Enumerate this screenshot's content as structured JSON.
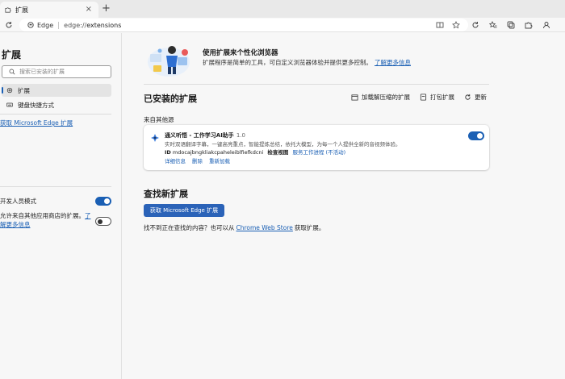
{
  "tab": {
    "title": "扩展",
    "close": "×",
    "new_tab": "+"
  },
  "address": {
    "site": "Edge",
    "url_prefix": "edge://",
    "url_path": "extensions"
  },
  "sidebar": {
    "title": "扩展",
    "search_placeholder": "搜索已安装的扩展",
    "items": [
      {
        "label": "扩展",
        "icon": "gear-icon",
        "active": true
      },
      {
        "label": "键盘快捷方式",
        "icon": "keyboard-icon",
        "active": false
      }
    ],
    "get_link": "获取 Microsoft Edge 扩展",
    "dev_mode_label": "开发人员模式",
    "allow_text": "允许来自其他应用商店的扩展。",
    "allow_link": "了解更多信息"
  },
  "hero": {
    "title": "使用扩展来个性化浏览器",
    "desc": "扩展程序是简单的工具，可自定义浏览器体验并提供更多控制。",
    "link": "了解更多信息"
  },
  "installed": {
    "title": "已安装的扩展",
    "actions": [
      {
        "label": "加载解压缩的扩展",
        "icon": "load-icon"
      },
      {
        "label": "打包扩展",
        "icon": "package-icon"
      },
      {
        "label": "更新",
        "icon": "refresh-icon"
      }
    ],
    "source_label": "来自其他源",
    "extension": {
      "name": "通义听悟 - 工作学习AI助手",
      "version": "1.0",
      "desc": "实时双语翻译字幕，一键高亮重点，智能提炼总结，依托大模型，为每一个人提供全新的音视频体验。",
      "id_label": "ID",
      "id_value": "mdocajbngkliakcpaheleiblfiefkdcni",
      "inspect_label": "检查视图",
      "inspect_link": "服务工作进程 (不活动)",
      "links": [
        "详细信息",
        "删除",
        "重新加载"
      ],
      "enabled": true
    }
  },
  "find": {
    "title": "查找新扩展",
    "button": "获取 Microsoft Edge 扩展",
    "prefix": "找不到正在查找的内容？也可以从",
    "store_link": "Chrome Web Store",
    "suffix": "获取扩展。"
  },
  "colors": {
    "accent": "#1a5fb4",
    "button": "#2b63b8"
  }
}
